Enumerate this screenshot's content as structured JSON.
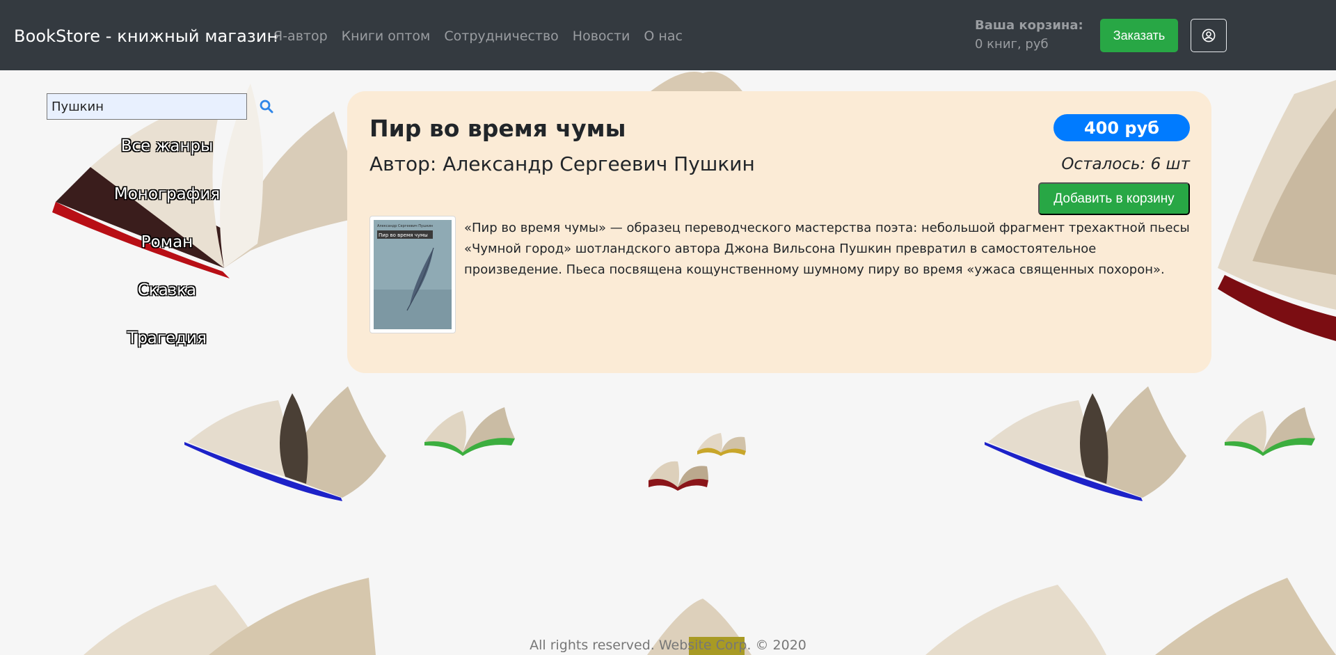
{
  "navbar": {
    "brand": "BookStore - книжный магазин",
    "links": [
      "Я-автор",
      "Книги оптом",
      "Сотрудничество",
      "Новости",
      "О нас"
    ],
    "cart_title": "Ваша корзина:",
    "cart_info": "0 книг, руб",
    "order_button": "Заказать",
    "user_icon": "user-circle-icon"
  },
  "sidebar": {
    "search_value": "Пушкин",
    "search_icon": "search-icon",
    "genres": [
      "Все жанры",
      "Монография",
      "Роман",
      "Сказка",
      "Трагедия"
    ]
  },
  "product": {
    "title": "Пир во время чумы",
    "author": "Автор: Александр Сергеевич Пушкин",
    "price": "400 руб",
    "stock": "Осталось: 6 шт",
    "add_to_cart": "Добавить в корзину",
    "cover": {
      "author": "Александр Сергеевич Пушкин",
      "title": "Пир во время чумы"
    },
    "description": "«Пир во время чумы» — образец переводческого мастерства поэта: небольшой фрагмент трехактной пьесы «Чумной город» шотландского автора Джона Вильсона Пушкин превратил в самостоятельное произведение. Пьеса посвящена кощунственному шумному пиру во время «ужаса священных похорон»."
  },
  "footer": {
    "text": "All rights reserved. Website Corp. © 2020"
  },
  "colors": {
    "navbar_bg": "#343a40",
    "success": "#28a745",
    "primary": "#007bff",
    "card_bg": "#fbebd6"
  }
}
